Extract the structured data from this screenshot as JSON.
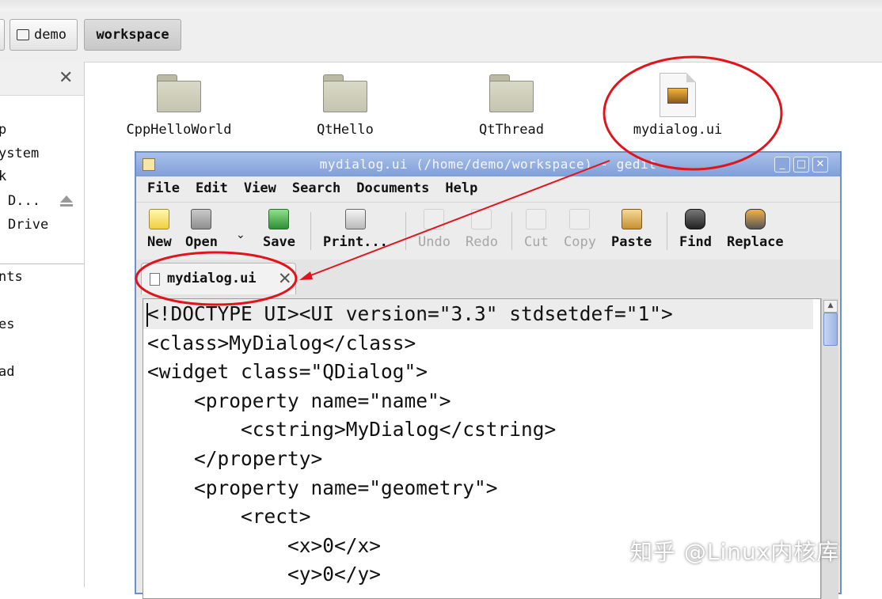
{
  "breadcrumb": {
    "items": [
      "demo",
      "workspace"
    ]
  },
  "sidebar": {
    "items": [
      "p",
      "ystem",
      "k",
      "D...",
      "Drive",
      "nts",
      "es",
      "ad"
    ]
  },
  "files": [
    {
      "name": "CppHelloWorld",
      "icon": "folder-icon"
    },
    {
      "name": "QtHello",
      "icon": "folder-icon"
    },
    {
      "name": "QtThread",
      "icon": "folder-icon"
    },
    {
      "name": "mydialog.ui",
      "icon": "ui-file-icon"
    }
  ],
  "gedit": {
    "title": "mydialog.ui (/home/demo/workspace) - gedit",
    "menu": [
      "File",
      "Edit",
      "View",
      "Search",
      "Documents",
      "Help"
    ],
    "toolbar": {
      "new": "New",
      "open": "Open",
      "save": "Save",
      "print": "Print...",
      "undo": "Undo",
      "redo": "Redo",
      "cut": "Cut",
      "copy": "Copy",
      "paste": "Paste",
      "find": "Find",
      "replace": "Replace"
    },
    "tab_label": "mydialog.ui",
    "code_lines": [
      "<!DOCTYPE UI><UI version=\"3.3\" stdsetdef=\"1\">",
      "<class>MyDialog</class>",
      "<widget class=\"QDialog\">",
      "    <property name=\"name\">",
      "        <cstring>MyDialog</cstring>",
      "    </property>",
      "    <property name=\"geometry\">",
      "        <rect>",
      "            <x>0</x>",
      "            <y>0</y>"
    ]
  },
  "watermark": "知乎 @Linux内核库",
  "colors": {
    "annotation": "#e0141c",
    "titlebar": "#7f9fd8"
  }
}
